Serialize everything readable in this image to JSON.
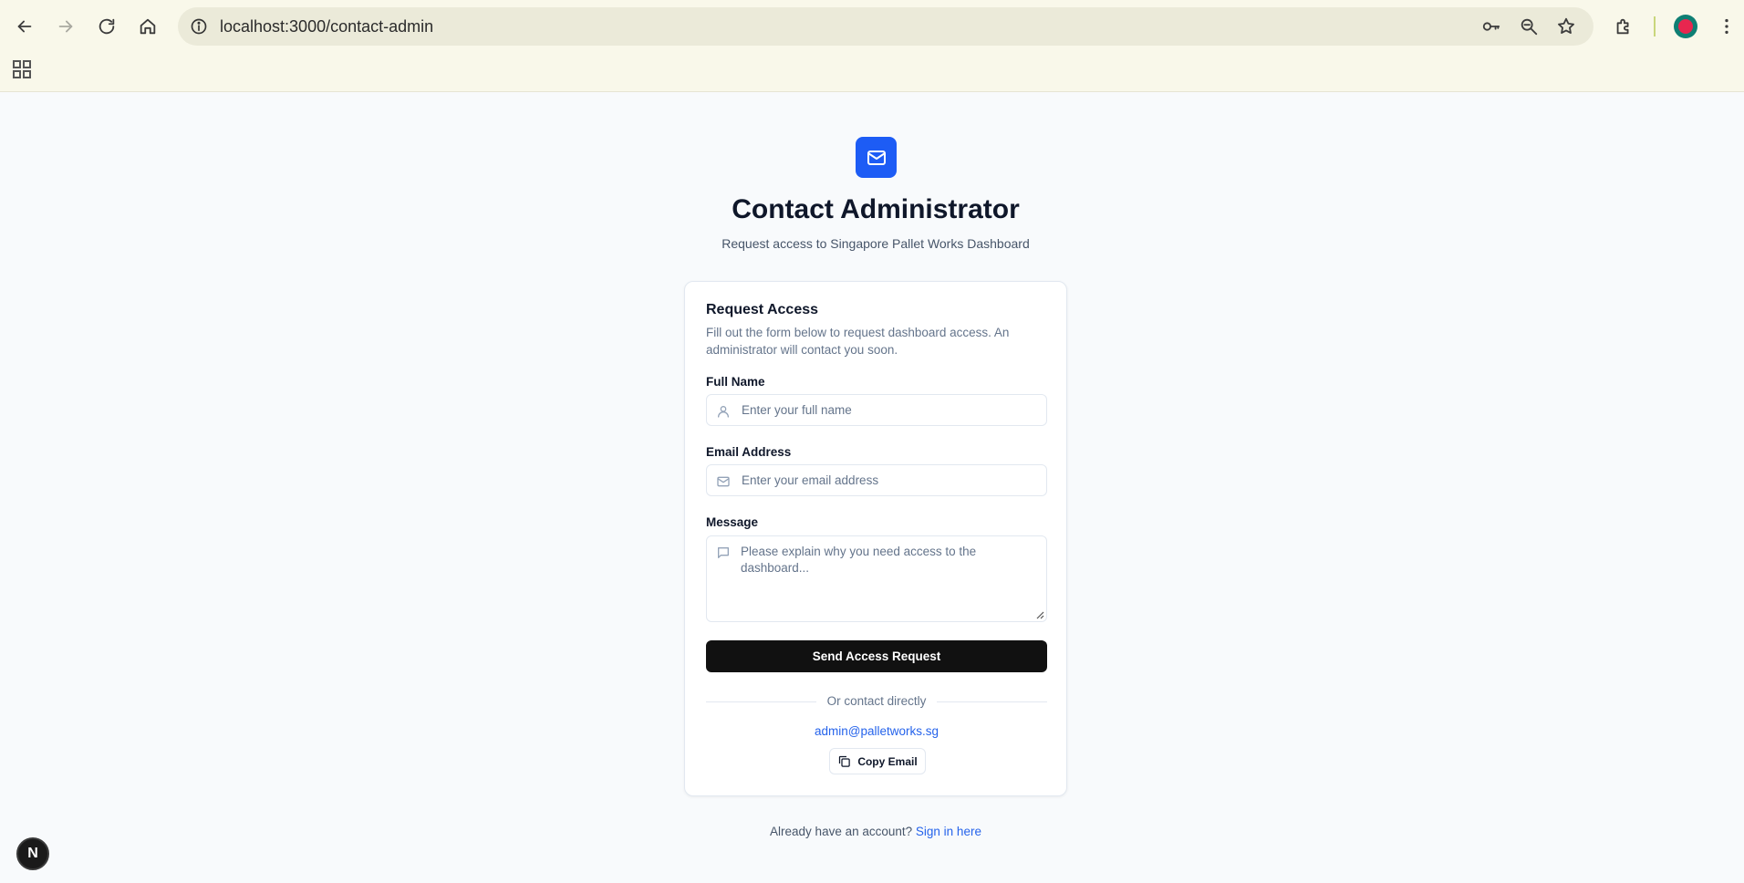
{
  "browser": {
    "url": "localhost:3000/contact-admin",
    "icons": [
      "back-icon",
      "forward-icon",
      "reload-icon",
      "home-icon",
      "site-info-icon",
      "key-icon",
      "zoom-icon",
      "star-icon",
      "extensions-icon",
      "profile-avatar",
      "menu-icon",
      "apps-icon"
    ]
  },
  "header": {
    "title": "Contact Administrator",
    "subtitle": "Request access to Singapore Pallet Works Dashboard"
  },
  "form": {
    "title": "Request Access",
    "description": "Fill out the form below to request dashboard access. An administrator will contact you soon.",
    "full_name": {
      "label": "Full Name",
      "placeholder": "Enter your full name"
    },
    "email": {
      "label": "Email Address",
      "placeholder": "Enter your email address"
    },
    "message": {
      "label": "Message",
      "placeholder": "Please explain why you need access to the dashboard..."
    },
    "submit_label": "Send Access Request",
    "divider_text": "Or contact directly",
    "admin_email": "admin@palletworks.sg",
    "copy_label": "Copy Email"
  },
  "footer": {
    "prompt": "Already have an account?",
    "link": "Sign in here"
  },
  "dev_badge": "N",
  "colors": {
    "accent": "#1d5cf5",
    "link": "#2563eb",
    "button": "#111111",
    "page_bg": "#f8fafc",
    "chrome_bg": "#f9f8ea"
  }
}
